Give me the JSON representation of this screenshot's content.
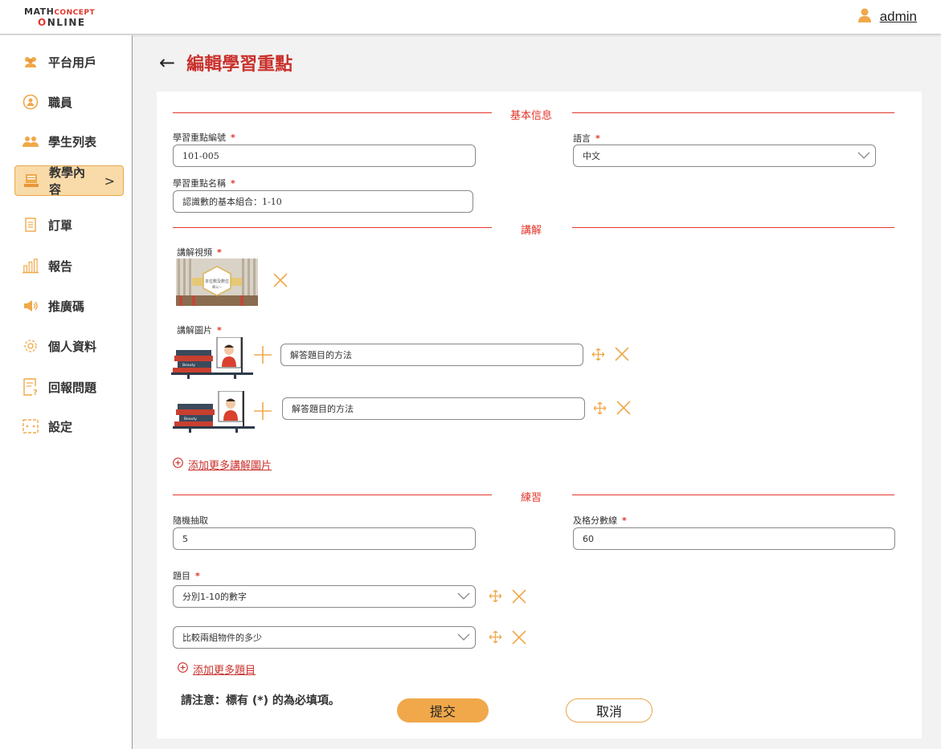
{
  "logo": {
    "line1_a": "MATH",
    "line1_b": "CONCEPT",
    "line2_a": "O",
    "line2_b": "NLINE"
  },
  "user": {
    "name": "admin"
  },
  "sidebar": {
    "items": [
      {
        "label": "平台用戶",
        "icon": "users-icon"
      },
      {
        "label": "職員",
        "icon": "staff-icon"
      },
      {
        "label": "學生列表",
        "icon": "students-icon"
      },
      {
        "label": "教學內容",
        "icon": "book-icon",
        "active": true
      },
      {
        "label": "訂單",
        "icon": "receipt-icon"
      },
      {
        "label": "報告",
        "icon": "bar-chart-icon"
      },
      {
        "label": "推廣碼",
        "icon": "megaphone-icon"
      },
      {
        "label": "個人資料",
        "icon": "gear-icon"
      },
      {
        "label": "回報問題",
        "icon": "report-icon"
      },
      {
        "label": "設定",
        "icon": "settings-icon"
      }
    ]
  },
  "page": {
    "title": "編輯學習重點"
  },
  "sections": {
    "basic": "基本信息",
    "explain": "講解",
    "practice": "練習"
  },
  "basic": {
    "code_label": "學習重點編號",
    "code_value": "101-005",
    "lang_label": "語言",
    "lang_value": "中文",
    "name_label": "學習重點名稱",
    "name_value": "認識數的基本組合：1-10"
  },
  "explain": {
    "video_label": "講解視頻",
    "video_caption_a": "本位數及數位",
    "video_caption_b": "單元一",
    "images_label": "講解圖片",
    "images": [
      {
        "caption": "解答題目的方法",
        "book_label": "Beauty"
      },
      {
        "caption": "解答題目的方法",
        "book_label": "Beauty"
      }
    ],
    "add_more": "添加更多講解圖片"
  },
  "practice": {
    "random_label": "隨機抽取",
    "random_value": "5",
    "pass_label": "及格分數線",
    "pass_value": "60",
    "questions_label": "題目",
    "questions": [
      "分別1-10的數字",
      "比較兩組物件的多少"
    ],
    "add_more": "添加更多題目"
  },
  "footer": {
    "note": "請注意：標有 (*) 的為必填項。",
    "submit": "提交",
    "cancel": "取消",
    "required_mark": "*"
  },
  "colors": {
    "accent_red": "#e2352b",
    "title_red": "#c9302c",
    "orange": "#f0a84a",
    "active_bg": "#f9dba9"
  }
}
